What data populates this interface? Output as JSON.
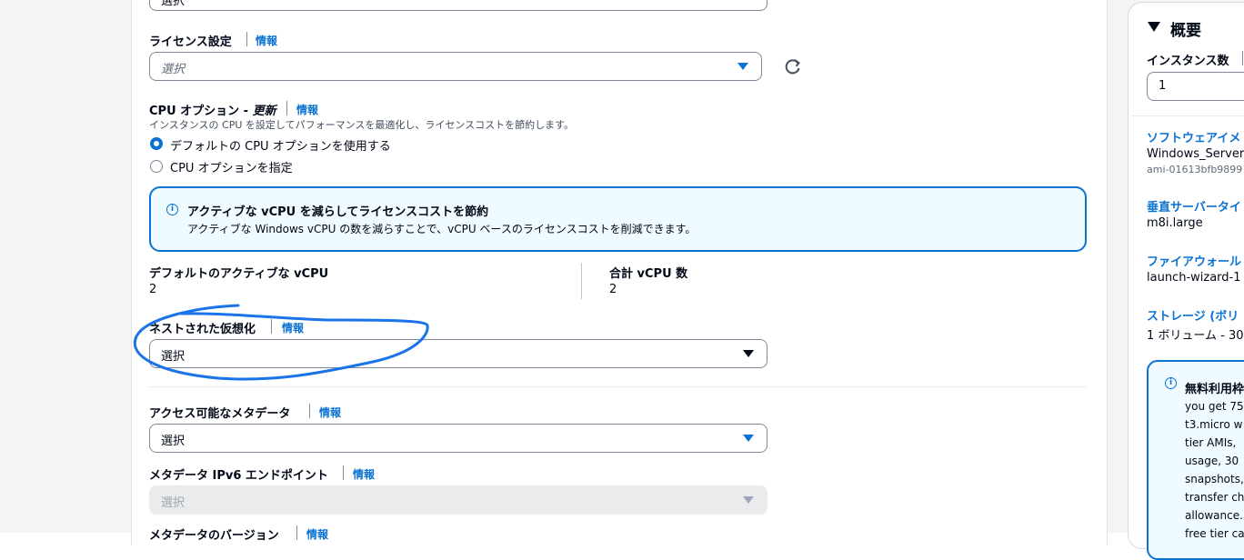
{
  "main": {
    "top_select": {
      "value": "選択"
    },
    "license": {
      "label": "ライセンス設定",
      "info": "情報",
      "placeholder": "選択"
    },
    "cpu": {
      "label_prefix": "CPU オプション - ",
      "label_emphasis": "更新",
      "info": "情報",
      "description": "インスタンスの CPU を設定してパフォーマンスを最適化し、ライセンスコストを節約します。",
      "options": [
        "デフォルトの CPU オプションを使用する",
        "CPU オプションを指定"
      ],
      "selected_index": 0
    },
    "alert": {
      "title": "アクティブな vCPU を減らしてライセンスコストを節約",
      "body": "アクティブな Windows vCPU の数を減らすことで、vCPU ベースのライセンスコストを削減できます。"
    },
    "default_vcpu": {
      "label": "デフォルトのアクティブな vCPU",
      "value": "2"
    },
    "total_vcpu": {
      "label": "合計 vCPU 数",
      "value": "2"
    },
    "nested_virtualization": {
      "label": "ネストされた仮想化",
      "info": "情報",
      "value": "選択"
    },
    "metadata_accessible": {
      "label": "アクセス可能なメタデータ",
      "info": "情報",
      "value": "選択"
    },
    "metadata_ipv6": {
      "label": "メタデータ IPv6 エンドポイント",
      "info": "情報",
      "value": "選択"
    },
    "metadata_version": {
      "label": "メタデータのバージョン",
      "info": "情報"
    }
  },
  "summary": {
    "title": "概要",
    "instance_count_label": "インスタンス数",
    "instance_count_value": "1",
    "software_image_label": "ソフトウェアイメ",
    "software_image_value": "Windows_Server-",
    "software_image_id": "ami-01613bfb9899",
    "server_type_label": "垂直サーバータイ",
    "server_type_value": "m8i.large",
    "firewall_label": "ファイアウォール",
    "firewall_value": "launch-wizard-1",
    "storage_label": "ストレージ (ボリ",
    "storage_value": "1 ボリューム - 30",
    "free_tier": {
      "title": "無料利用枠",
      "lines": [
        "you get 75",
        "t3.micro w",
        "tier AMIs, ",
        "usage, 30 ",
        "snapshots,",
        "transfer ch",
        "allowance.",
        "free tier ca"
      ]
    }
  },
  "colors": {
    "accent": "#0972d3",
    "annotation": "#1a73e8"
  }
}
